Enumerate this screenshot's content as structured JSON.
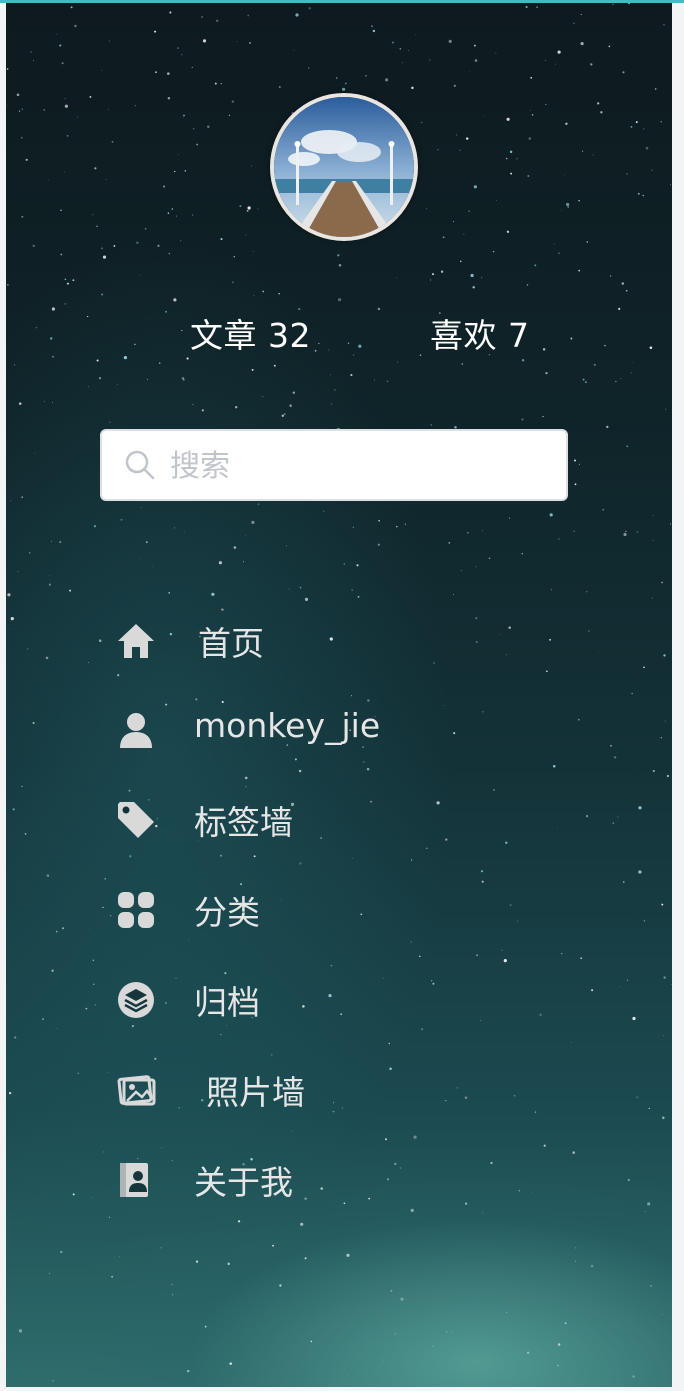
{
  "profile": {
    "stats": [
      {
        "label": "文章",
        "value": "32"
      },
      {
        "label": "喜欢",
        "value": "7"
      }
    ]
  },
  "search": {
    "placeholder": "搜索",
    "value": ""
  },
  "nav": {
    "items": [
      {
        "label": "首页",
        "icon": "home-icon"
      },
      {
        "label": "monkey_jie",
        "icon": "user-icon"
      },
      {
        "label": "标签墙",
        "icon": "tag-icon"
      },
      {
        "label": "分类",
        "icon": "grid-icon"
      },
      {
        "label": "归档",
        "icon": "layers-icon"
      },
      {
        "label": "照片墙",
        "icon": "photos-icon"
      },
      {
        "label": "关于我",
        "icon": "contact-book-icon"
      }
    ]
  },
  "colors": {
    "accent_line": "#49b7c4",
    "nav_text": "#e6e6e6",
    "icon": "#d9d9d9"
  }
}
